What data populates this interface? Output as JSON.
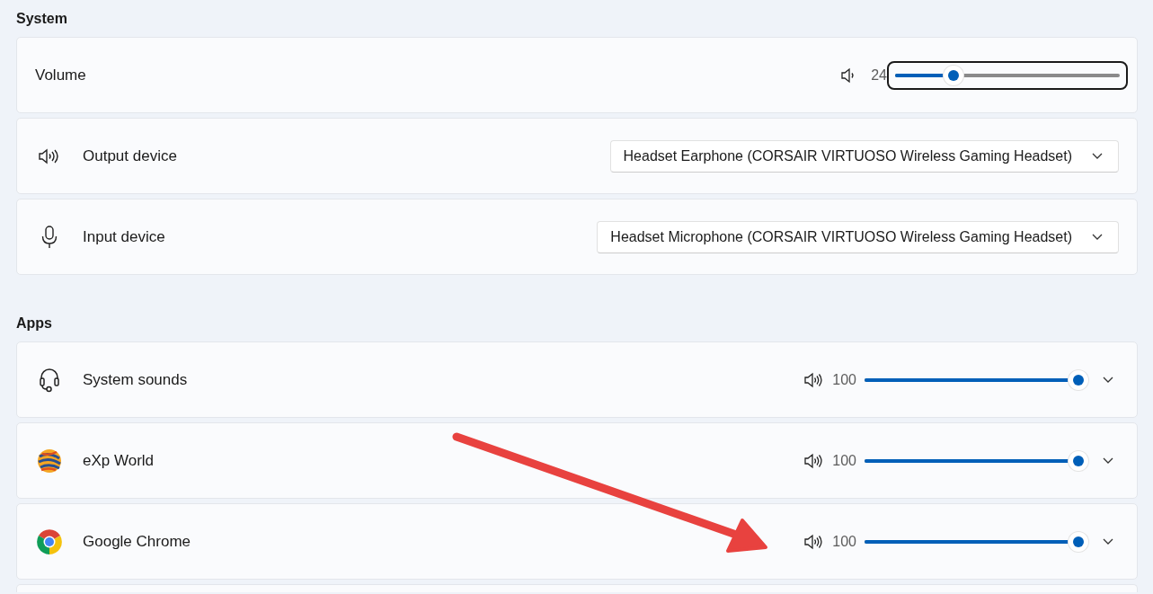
{
  "sections": [
    {
      "title": "System",
      "rows": [
        {
          "kind": "volume",
          "label": "Volume",
          "reading": "24",
          "level": 0.26,
          "focused": true
        },
        {
          "kind": "output-device",
          "label": "Output device",
          "value": "Headset Earphone (CORSAIR VIRTUOSO Wireless Gaming Headset)"
        },
        {
          "kind": "input-device",
          "label": "Input device",
          "value": "Headset Microphone (CORSAIR VIRTUOSO Wireless Gaming Headset)"
        }
      ]
    },
    {
      "title": "Apps",
      "rows": [
        {
          "kind": "app",
          "label": "System sounds",
          "reading": "100",
          "level": 1,
          "focused": false
        },
        {
          "kind": "app",
          "label": "eXp World",
          "reading": "100",
          "level": 1,
          "focused": false
        },
        {
          "kind": "app",
          "label": "Google Chrome",
          "reading": "100",
          "level": 1,
          "focused": false
        },
        {
          "kind": "empty"
        }
      ]
    }
  ],
  "annotation": {
    "kind": "arrow"
  }
}
